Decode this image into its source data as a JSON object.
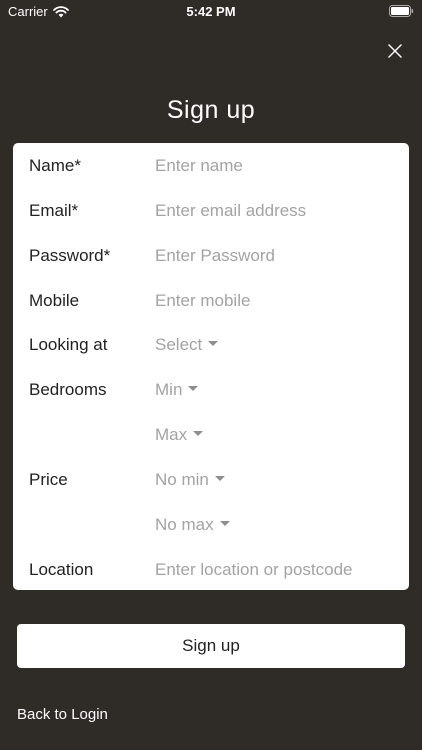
{
  "status_bar": {
    "carrier": "Carrier",
    "time": "5:42 PM"
  },
  "header": {
    "title": "Sign up"
  },
  "form": {
    "name": {
      "label": "Name*",
      "placeholder": "Enter name"
    },
    "email": {
      "label": "Email*",
      "placeholder": "Enter email address"
    },
    "password": {
      "label": "Password*",
      "placeholder": "Enter Password"
    },
    "mobile": {
      "label": "Mobile",
      "placeholder": "Enter mobile"
    },
    "looking_at": {
      "label": "Looking at",
      "value": "Select"
    },
    "bedrooms": {
      "label": "Bedrooms",
      "min": "Min",
      "max": "Max"
    },
    "price": {
      "label": "Price",
      "min": "No min",
      "max": "No max"
    },
    "location": {
      "label": "Location",
      "placeholder": "Enter location or postcode"
    }
  },
  "actions": {
    "signup_label": "Sign up",
    "back_label": "Back to Login"
  },
  "icons": {
    "close": "close-icon",
    "wifi": "wifi-icon",
    "battery": "battery-icon",
    "dropdown": "caret-down-icon"
  },
  "colors": {
    "background": "#2f2b27",
    "card": "#ffffff",
    "placeholder": "#a3a3a3"
  }
}
